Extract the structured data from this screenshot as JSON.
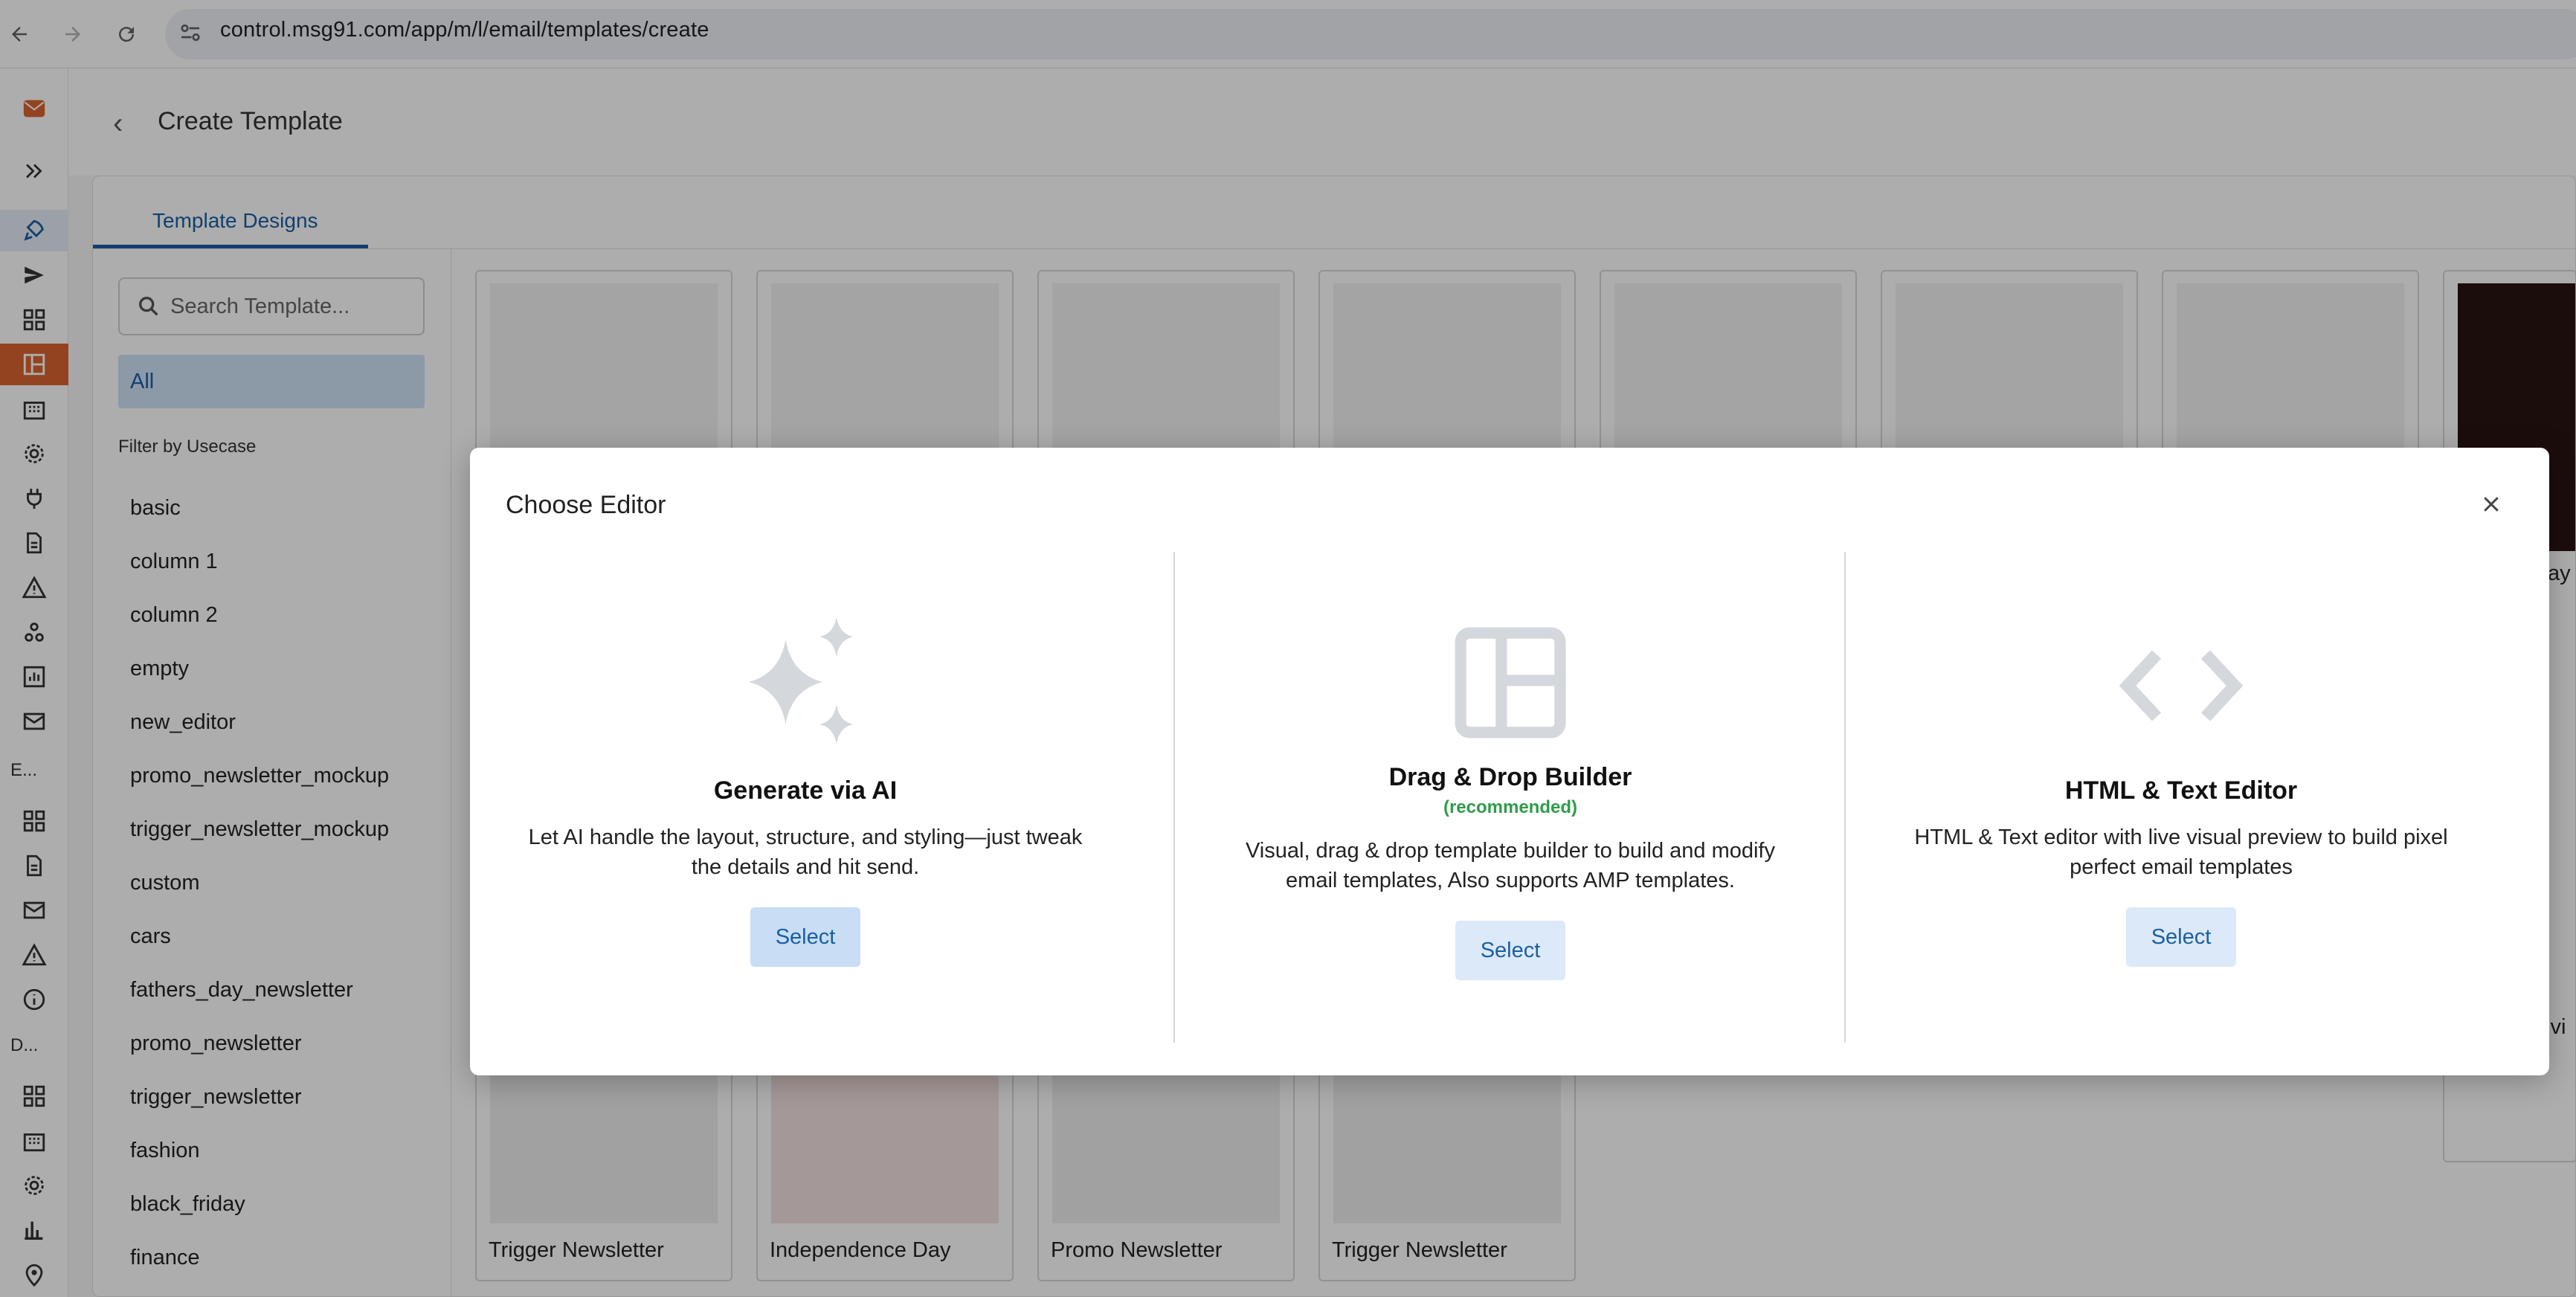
{
  "browser": {
    "url": "control.msg91.com/app/m/l/email/templates/create",
    "back_icon": "back-arrow-icon",
    "forward_icon": "forward-arrow-icon",
    "reload_icon": "reload-icon",
    "site_info_icon": "site-settings-icon"
  },
  "rail": {
    "accent_color": "#d9642f",
    "section_label_1": "E...",
    "section_label_2": "D..."
  },
  "header": {
    "title": "Create Template"
  },
  "tabs": [
    {
      "label": "Template Designs",
      "active": true
    }
  ],
  "sidebar": {
    "search_placeholder": "Search Template...",
    "all_label": "All",
    "filter_title": "Filter by Usecase",
    "filters": [
      "basic",
      "column 1",
      "column 2",
      "empty",
      "new_editor",
      "promo_newsletter_mockup",
      "trigger_newsletter_mockup",
      "custom",
      "cars",
      "fathers_day_newsletter",
      "promo_newsletter",
      "trigger_newsletter",
      "fashion",
      "black_friday",
      "finance"
    ]
  },
  "templates": {
    "bottom_labels": [
      "Trigger Newsletter",
      "Independence Day",
      "Promo Newsletter",
      "Trigger Newsletter"
    ],
    "partial_text_1": "Day",
    "partial_text_2": "ivi"
  },
  "modal": {
    "title": "Choose Editor",
    "close_icon": "close-icon",
    "options": [
      {
        "title": "Generate via AI",
        "subtitle": "",
        "description": "Let AI handle the layout, structure, and styling—just tweak the details and hit send.",
        "button": "Select",
        "icon": "sparkles-icon"
      },
      {
        "title": "Drag & Drop Builder",
        "subtitle": "(recommended)",
        "description": "Visual, drag & drop template builder to build and modify email templates, Also supports AMP templates.",
        "button": "Select",
        "icon": "layout-icon"
      },
      {
        "title": "HTML & Text Editor",
        "subtitle": "",
        "description": "HTML & Text editor with live visual preview to build pixel perfect email templates",
        "button": "Select",
        "icon": "code-icon"
      }
    ]
  }
}
